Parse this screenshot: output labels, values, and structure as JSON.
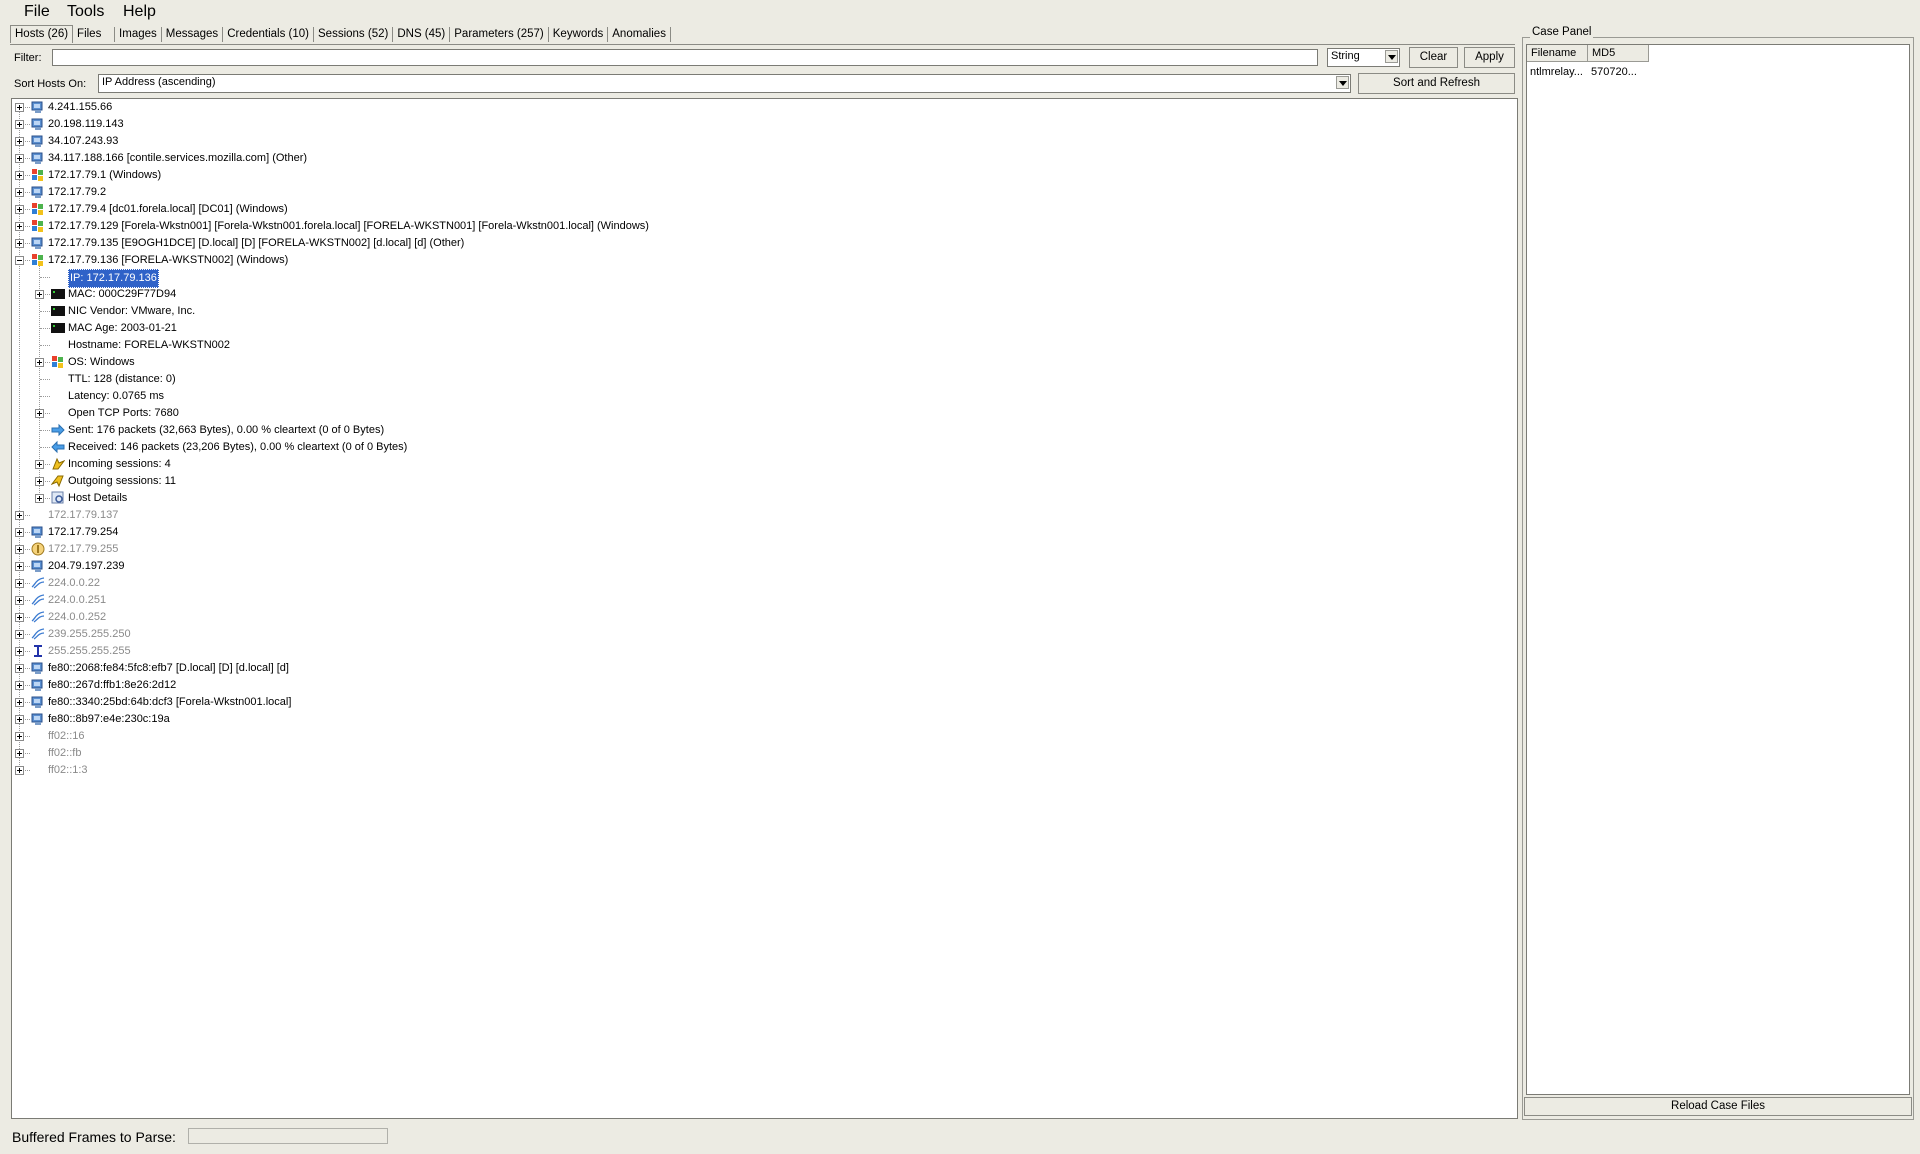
{
  "menu": [
    "File",
    "Tools",
    "Help"
  ],
  "tabs": [
    "Hosts (26)",
    "Files",
    "Images",
    "Messages",
    "Credentials (10)",
    "Sessions (52)",
    "DNS (45)",
    "Parameters (257)",
    "Keywords",
    "Anomalies"
  ],
  "filter": {
    "label": "Filter:",
    "value": "",
    "type": "String",
    "clear": "Clear",
    "apply": "Apply"
  },
  "sort": {
    "label": "Sort Hosts On:",
    "value": "IP Address (ascending)",
    "button": "Sort and Refresh"
  },
  "tree": [
    {
      "text": "4.241.155.66",
      "level": 0,
      "icon": "network-host-icon",
      "expand": "plus",
      "grey": false
    },
    {
      "text": "20.198.119.143",
      "level": 0,
      "icon": "network-host-icon",
      "expand": "plus",
      "grey": false
    },
    {
      "text": "34.107.243.93",
      "level": 0,
      "icon": "network-host-icon",
      "expand": "plus",
      "grey": false
    },
    {
      "text": "34.117.188.166 [contile.services.mozilla.com] (Other)",
      "level": 0,
      "icon": "network-host-icon",
      "expand": "plus",
      "grey": false
    },
    {
      "text": "172.17.79.1 (Windows)",
      "level": 0,
      "icon": "windows-icon",
      "expand": "plus",
      "grey": false
    },
    {
      "text": "172.17.79.2",
      "level": 0,
      "icon": "network-host-icon",
      "expand": "plus",
      "grey": false
    },
    {
      "text": "172.17.79.4 [dc01.forela.local] [DC01] (Windows)",
      "level": 0,
      "icon": "windows-icon",
      "expand": "plus",
      "grey": false
    },
    {
      "text": "172.17.79.129 [Forela-Wkstn001] [Forela-Wkstn001.forela.local] [FORELA-WKSTN001] [Forela-Wkstn001.local] (Windows)",
      "level": 0,
      "icon": "windows-icon",
      "expand": "plus",
      "grey": false
    },
    {
      "text": "172.17.79.135 [E9OGH1DCE] [D.local] [D] [FORELA-WKSTN002] [d.local] [d] (Other)",
      "level": 0,
      "icon": "network-host-icon",
      "expand": "plus",
      "grey": false
    },
    {
      "text": "172.17.79.136 [FORELA-WKSTN002] (Windows)",
      "level": 0,
      "icon": "windows-icon",
      "expand": "minus",
      "grey": false
    },
    {
      "text": "IP: 172.17.79.136",
      "level": 1,
      "icon": "",
      "expand": "",
      "grey": false,
      "selected": true
    },
    {
      "text": "MAC: 000C29F77D94",
      "level": 1,
      "icon": "nic-icon",
      "expand": "plus",
      "grey": false
    },
    {
      "text": "NIC Vendor: VMware, Inc.",
      "level": 1,
      "icon": "nic-icon",
      "expand": "",
      "grey": false
    },
    {
      "text": "MAC Age: 2003-01-21",
      "level": 1,
      "icon": "nic-icon",
      "expand": "",
      "grey": false
    },
    {
      "text": "Hostname: FORELA-WKSTN002",
      "level": 1,
      "icon": "",
      "expand": "",
      "grey": false
    },
    {
      "text": "OS: Windows",
      "level": 1,
      "icon": "windows-icon",
      "expand": "plus",
      "grey": false
    },
    {
      "text": "TTL: 128 (distance: 0)",
      "level": 1,
      "icon": "",
      "expand": "",
      "grey": false
    },
    {
      "text": "Latency: 0.0765 ms",
      "level": 1,
      "icon": "",
      "expand": "",
      "grey": false
    },
    {
      "text": "Open TCP Ports: 7680",
      "level": 1,
      "icon": "",
      "expand": "plus",
      "grey": false
    },
    {
      "text": "Sent: 176 packets (32,663 Bytes), 0.00 % cleartext (0 of 0 Bytes)",
      "level": 1,
      "icon": "arrow-right-icon",
      "expand": "",
      "grey": false
    },
    {
      "text": "Received: 146 packets (23,206 Bytes), 0.00 % cleartext (0 of 0 Bytes)",
      "level": 1,
      "icon": "arrow-left-icon",
      "expand": "",
      "grey": false
    },
    {
      "text": "Incoming sessions: 4",
      "level": 1,
      "icon": "incoming-icon",
      "expand": "plus",
      "grey": false
    },
    {
      "text": "Outgoing sessions: 11",
      "level": 1,
      "icon": "outgoing-icon",
      "expand": "plus",
      "grey": false
    },
    {
      "text": "Host Details",
      "level": 1,
      "icon": "details-icon",
      "expand": "plus",
      "grey": false
    },
    {
      "text": "172.17.79.137",
      "level": 0,
      "icon": "",
      "expand": "plus",
      "grey": true
    },
    {
      "text": "172.17.79.254",
      "level": 0,
      "icon": "network-host-icon",
      "expand": "plus",
      "grey": false
    },
    {
      "text": "172.17.79.255",
      "level": 0,
      "icon": "broadcast-icon",
      "expand": "plus",
      "grey": true
    },
    {
      "text": "204.79.197.239",
      "level": 0,
      "icon": "network-host-icon",
      "expand": "plus",
      "grey": false
    },
    {
      "text": "224.0.0.22",
      "level": 0,
      "icon": "multicast-icon",
      "expand": "plus",
      "grey": true
    },
    {
      "text": "224.0.0.251",
      "level": 0,
      "icon": "multicast-icon",
      "expand": "plus",
      "grey": true
    },
    {
      "text": "224.0.0.252",
      "level": 0,
      "icon": "multicast-icon",
      "expand": "plus",
      "grey": true
    },
    {
      "text": "239.255.255.250",
      "level": 0,
      "icon": "multicast-icon",
      "expand": "plus",
      "grey": true
    },
    {
      "text": "255.255.255.255",
      "level": 0,
      "icon": "ibeam-icon",
      "expand": "plus",
      "grey": true
    },
    {
      "text": "fe80::2068:fe84:5fc8:efb7 [D.local] [D] [d.local] [d]",
      "level": 0,
      "icon": "network-host-icon",
      "expand": "plus",
      "grey": false
    },
    {
      "text": "fe80::267d:ffb1:8e26:2d12",
      "level": 0,
      "icon": "network-host-icon",
      "expand": "plus",
      "grey": false
    },
    {
      "text": "fe80::3340:25bd:64b:dcf3 [Forela-Wkstn001.local]",
      "level": 0,
      "icon": "network-host-icon",
      "expand": "plus",
      "grey": false
    },
    {
      "text": "fe80::8b97:e4e:230c:19a",
      "level": 0,
      "icon": "network-host-icon",
      "expand": "plus",
      "grey": false
    },
    {
      "text": "ff02::16",
      "level": 0,
      "icon": "",
      "expand": "plus",
      "grey": true
    },
    {
      "text": "ff02::fb",
      "level": 0,
      "icon": "",
      "expand": "plus",
      "grey": true
    },
    {
      "text": "ff02::1:3",
      "level": 0,
      "icon": "",
      "expand": "plus",
      "grey": true
    }
  ],
  "case_panel": {
    "title": "Case Panel",
    "columns": [
      "Filename",
      "MD5"
    ],
    "rows": [
      [
        "ntlmrelay...",
        "570720..."
      ]
    ],
    "reload": "Reload Case Files"
  },
  "status": {
    "label": "Buffered Frames to Parse:"
  },
  "colors": {
    "selection": "#2f62c8",
    "background": "#ecebe3"
  }
}
